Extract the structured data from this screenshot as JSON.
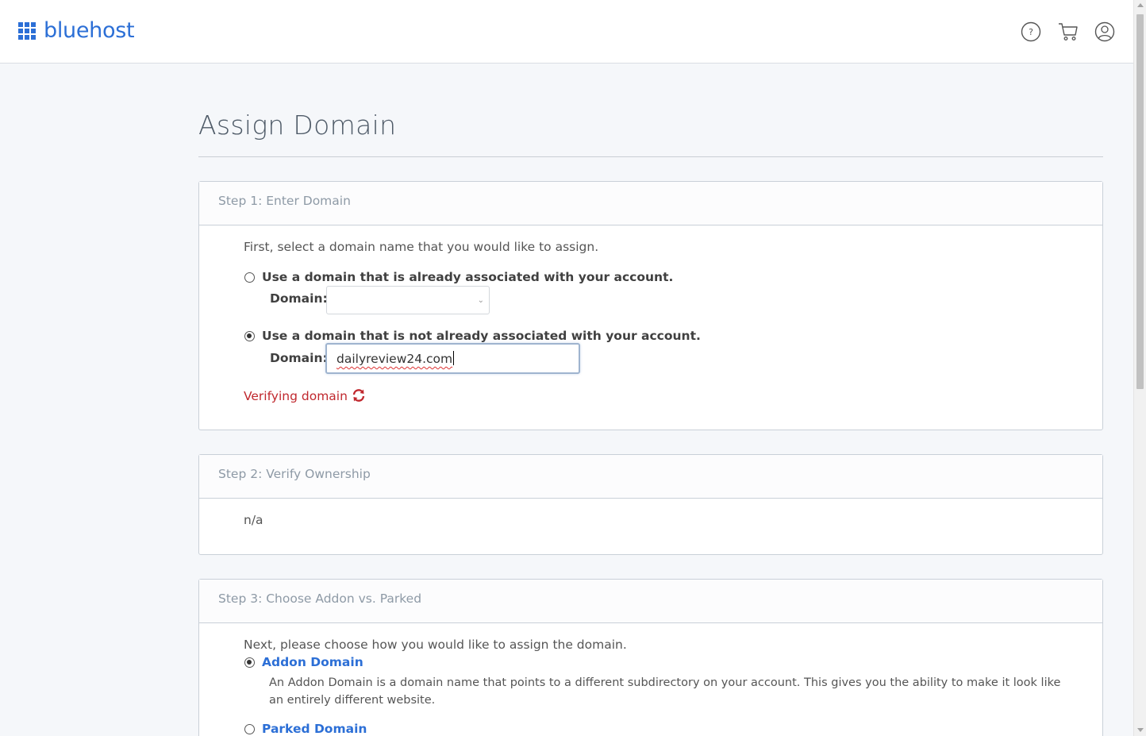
{
  "brand": {
    "name": "bluehost",
    "color": "#2c6fd6"
  },
  "header": {
    "icons": [
      "help-icon",
      "cart-icon",
      "account-icon"
    ]
  },
  "page": {
    "title": "Assign Domain"
  },
  "step1": {
    "title": "Step 1: Enter Domain",
    "intro": "First, select a domain name that you would like to assign.",
    "option_existing": {
      "label": "Use a domain that is already associated with your account.",
      "selected": false
    },
    "option_existing_domain_label": "Domain:",
    "existing_domain_value": "",
    "option_new": {
      "label": "Use a domain that is not already associated with your account.",
      "selected": true
    },
    "option_new_domain_label": "Domain:",
    "new_domain_value": "dailyreview24.com",
    "status": "Verifying domain",
    "status_color": "#c0282e"
  },
  "step2": {
    "title": "Step 2: Verify Ownership",
    "body": "n/a"
  },
  "step3": {
    "title": "Step 3: Choose Addon vs. Parked",
    "intro": "Next, please choose how you would like to assign the domain.",
    "addon": {
      "label": "Addon Domain",
      "selected": true,
      "description": "An Addon Domain is a domain name that points to a different subdirectory on your account. This gives you the ability to make it look like an entirely different website."
    },
    "parked": {
      "label": "Parked Domain",
      "selected": false
    }
  }
}
